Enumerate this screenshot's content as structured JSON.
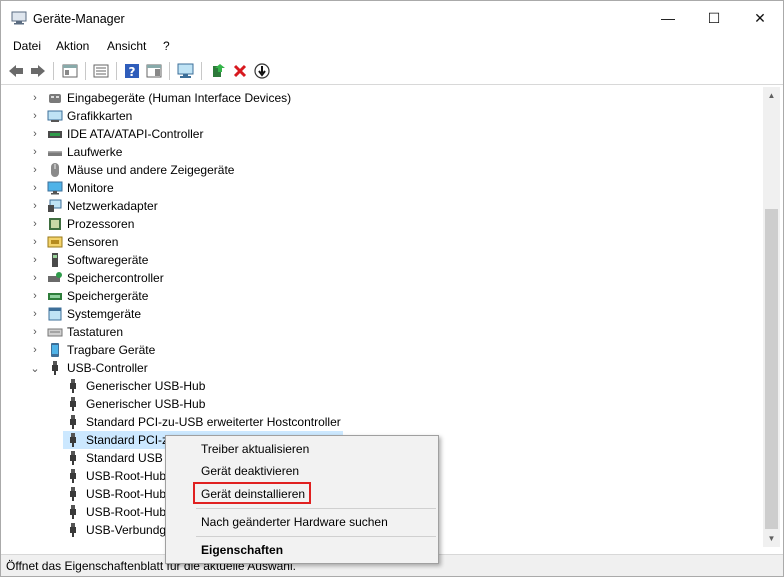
{
  "window": {
    "title": "Geräte-Manager",
    "controls": {
      "minimize": "—",
      "maximize": "☐",
      "close": "✕"
    }
  },
  "menu": [
    "Datei",
    "Aktion",
    "Ansicht",
    "?"
  ],
  "toolbar": {
    "icons": [
      "back-arrow-icon",
      "forward-arrow-icon",
      "properties-view-icon",
      "list-view-icon",
      "help-icon",
      "driver-details-icon",
      "monitor-scan-icon",
      "update-driver-icon",
      "uninstall-icon",
      "disable-device-icon"
    ]
  },
  "tree": {
    "categories": [
      {
        "label": "Eingabegeräte (Human Interface Devices)",
        "icon": "hid-icon"
      },
      {
        "label": "Grafikkarten",
        "icon": "display-adapter-icon"
      },
      {
        "label": "IDE ATA/ATAPI-Controller",
        "icon": "ide-controller-icon"
      },
      {
        "label": "Laufwerke",
        "icon": "disk-drive-icon"
      },
      {
        "label": "Mäuse und andere Zeigegeräte",
        "icon": "mouse-icon"
      },
      {
        "label": "Monitore",
        "icon": "monitor-icon"
      },
      {
        "label": "Netzwerkadapter",
        "icon": "network-adapter-icon"
      },
      {
        "label": "Prozessoren",
        "icon": "processor-icon"
      },
      {
        "label": "Sensoren",
        "icon": "sensor-icon"
      },
      {
        "label": "Softwaregeräte",
        "icon": "software-device-icon"
      },
      {
        "label": "Speichercontroller",
        "icon": "storage-controller-icon"
      },
      {
        "label": "Speichergeräte",
        "icon": "storage-device-icon"
      },
      {
        "label": "Systemgeräte",
        "icon": "system-device-icon"
      },
      {
        "label": "Tastaturen",
        "icon": "keyboard-icon"
      },
      {
        "label": "Tragbare Geräte",
        "icon": "portable-device-icon"
      },
      {
        "label": "USB-Controller",
        "icon": "usb-icon"
      }
    ],
    "usb_children": [
      "Generischer USB-Hub",
      "Generischer USB-Hub",
      "Standard PCI-zu-USB erweiterter Hostcontroller",
      "Standard PCI-z",
      "Standard USB 3",
      "USB-Root-Hub",
      "USB-Root-Hub",
      "USB-Root-Hub",
      "USB-Verbundge"
    ],
    "selected_child_index": 3
  },
  "context_menu": {
    "items": [
      "Treiber aktualisieren",
      "Gerät deaktivieren",
      "Gerät deinstallieren",
      "Nach geänderter Hardware suchen",
      "Eigenschaften"
    ],
    "highlight_color": "#e02020"
  },
  "status": "Öffnet das Eigenschaftenblatt für die aktuelle Auswahl."
}
